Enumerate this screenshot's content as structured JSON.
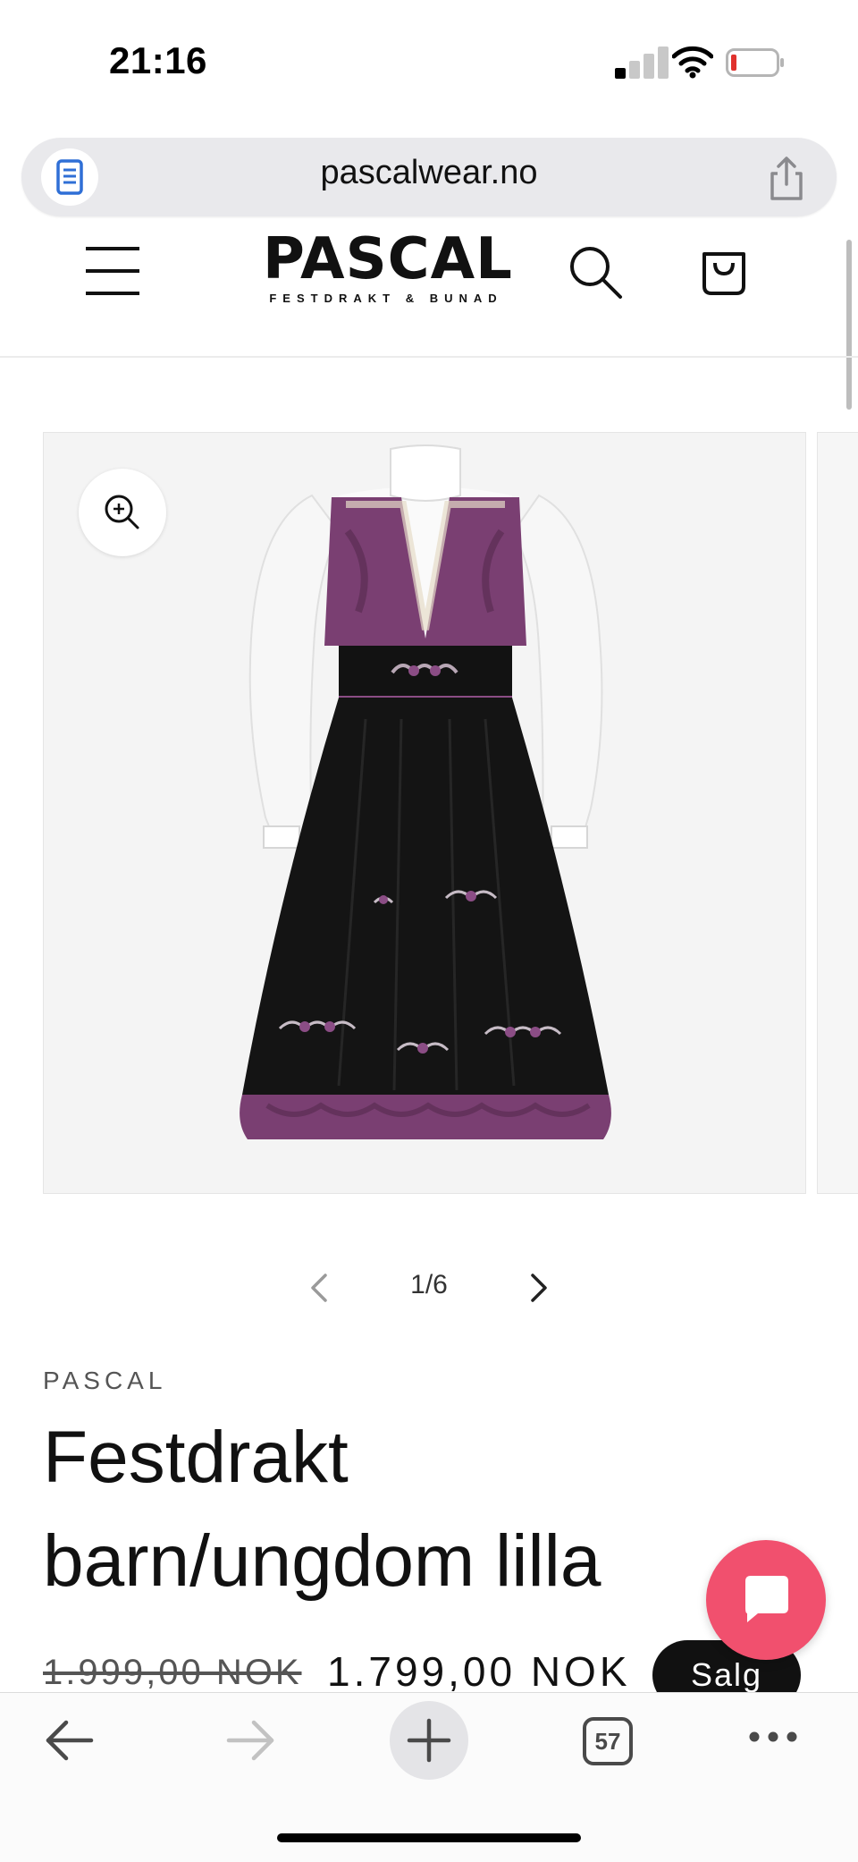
{
  "status_bar": {
    "time": "21:16",
    "icons": [
      "signal-icon",
      "wifi-icon",
      "battery-icon"
    ]
  },
  "browser": {
    "url": "pascalwear.no",
    "reader_icon": "reader-mode-icon",
    "share_icon": "share-icon",
    "open_tabs": "57",
    "toolbar_icons": [
      "back-arrow-icon",
      "forward-arrow-icon",
      "plus-icon",
      "tabs-icon",
      "more-icon"
    ]
  },
  "header": {
    "logo_main": "PASCAL",
    "logo_sub": "FESTDRAKT & BUNAD",
    "icons": [
      "menu-icon",
      "search-icon",
      "cart-icon"
    ]
  },
  "gallery": {
    "current": "1/6",
    "zoom_icon": "zoom-in-icon",
    "image_alt": "Festdrakt barn/ungdom lilla"
  },
  "product": {
    "vendor": "PASCAL",
    "title": "Festdrakt barn/ungdom lilla",
    "price_regular": "1.999,00 NOK",
    "price_sale": "1.799,00 NOK",
    "badge": "Salg"
  },
  "chat": {
    "icon": "chat-icon"
  },
  "colors": {
    "accent_chat": "#f1506e",
    "badge_bg": "#111111",
    "url_bar_bg": "#e9e9ec",
    "dress_purple": "#7a3f72",
    "battery_low": "#e0312d"
  }
}
